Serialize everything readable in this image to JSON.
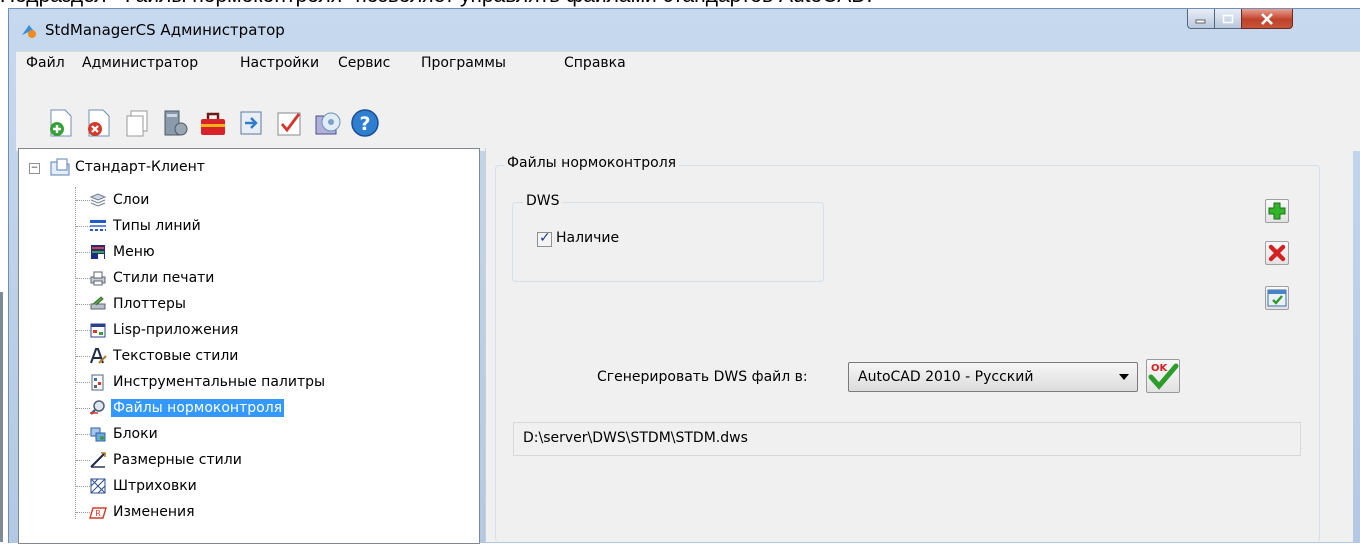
{
  "caption_text": "Подраздел \"Файлы нормоконтроля\" позволяет управлять файлами стандартов AutoCAD.",
  "window": {
    "title": "StdManagerCS Администратор",
    "controls": {
      "minimize": "minimize-icon",
      "maximize": "maximize-icon",
      "close": "close-icon"
    }
  },
  "menu": [
    "Файл",
    "Администратор",
    "Настройки",
    "Сервис",
    "Программы",
    "Справка"
  ],
  "toolbar_icons": [
    "add-doc-icon",
    "delete-doc-icon",
    "copy-icon",
    "server-icon",
    "toolbox-icon",
    "export-icon",
    "checklist-icon",
    "disk-config-icon",
    "help-icon"
  ],
  "tree": {
    "root": "Стандарт-Клиент",
    "items": [
      {
        "label": "Слои",
        "icon": "layers-icon"
      },
      {
        "label": "Типы линий",
        "icon": "linetypes-icon"
      },
      {
        "label": "Меню",
        "icon": "menu-icon"
      },
      {
        "label": "Стили печати",
        "icon": "printer-icon"
      },
      {
        "label": "Плоттеры",
        "icon": "plotter-icon"
      },
      {
        "label": "Lisp-приложения",
        "icon": "lisp-icon"
      },
      {
        "label": "Текстовые стили",
        "icon": "textstyle-icon"
      },
      {
        "label": "Инструментальные палитры",
        "icon": "palette-icon"
      },
      {
        "label": "Файлы нормоконтроля",
        "icon": "standards-icon",
        "selected": true
      },
      {
        "label": "Блоки",
        "icon": "blocks-icon"
      },
      {
        "label": "Размерные стили",
        "icon": "dimstyle-icon"
      },
      {
        "label": "Штриховки",
        "icon": "hatch-icon"
      },
      {
        "label": "Изменения",
        "icon": "changes-icon"
      }
    ]
  },
  "main": {
    "group_title": "Файлы нормоконтроля",
    "dws_group_title": "DWS",
    "dws_checkbox_label": "Наличие",
    "dws_checked": true,
    "generate_label": "Сгенерировать DWS файл в:",
    "select_value": "AutoCAD 2010 - Русский",
    "ok_icon_text": "OK",
    "path_value": "D:\\server\\DWS\\STDM\\STDM.dws"
  },
  "colors": {
    "selection": "#3399ff",
    "accent_green": "#2a9d2a",
    "accent_red": "#d42020"
  }
}
